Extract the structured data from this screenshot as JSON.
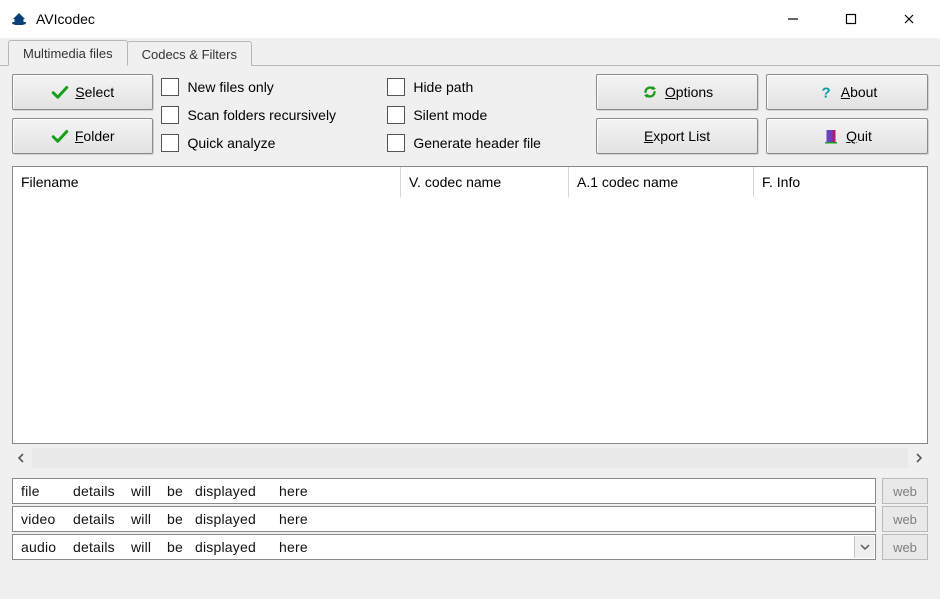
{
  "app": {
    "title": "AVIcodec"
  },
  "tabs": [
    {
      "label": "Multimedia files",
      "active": true
    },
    {
      "label": "Codecs & Filters",
      "active": false
    }
  ],
  "toolbar": {
    "select_u": "S",
    "select_rest": "elect",
    "folder_u": "F",
    "folder_rest": "older",
    "options_u": "O",
    "options_rest": "ptions",
    "about_u": "A",
    "about_rest": "bout",
    "export_u": "E",
    "export_rest": "xport List",
    "quit_u": "Q",
    "quit_rest": "uit"
  },
  "checkboxes": {
    "col1": [
      {
        "label": "New files only"
      },
      {
        "label": "Scan folders recursively"
      },
      {
        "label": "Quick analyze"
      }
    ],
    "col2": [
      {
        "label": "Hide path"
      },
      {
        "label": "Silent mode"
      },
      {
        "label": "Generate header file"
      }
    ]
  },
  "columns": {
    "c1": "Filename",
    "c2": "V. codec name",
    "c3": "A.1 codec name",
    "c4": "F. Info"
  },
  "details": {
    "row1": {
      "w1": "file",
      "w2": "details",
      "w3": "will",
      "w4": "be",
      "w5": "displayed",
      "w6": "here"
    },
    "row2": {
      "w1": "video",
      "w2": "details",
      "w3": "will",
      "w4": "be",
      "w5": "displayed",
      "w6": "here"
    },
    "row3": {
      "w1": "audio",
      "w2": "details",
      "w3": "will",
      "w4": "be",
      "w5": "displayed",
      "w6": "here"
    },
    "web_label": "web"
  }
}
